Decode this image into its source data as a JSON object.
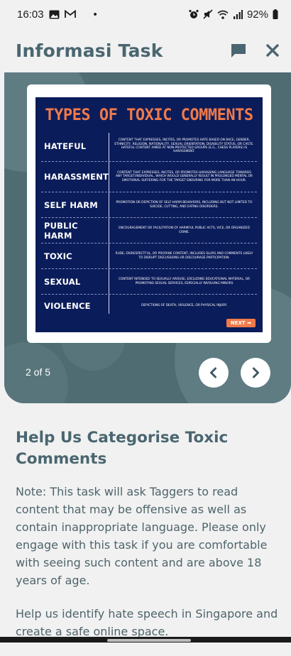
{
  "status_bar": {
    "time": "16:03",
    "dot": "•",
    "battery": "92%",
    "icons": [
      "gallery-icon",
      "gmail-icon",
      "alarm-icon",
      "mute-icon",
      "wifi-icon",
      "signal-icon",
      "battery-icon"
    ]
  },
  "header": {
    "title": "Informasi Task",
    "icons": [
      "chat-icon",
      "close-icon"
    ]
  },
  "carousel": {
    "slide": {
      "title": "TYPES OF TOXIC COMMENTS",
      "rows": [
        {
          "category": "HATEFUL",
          "description": "Content that expresses, incites, or promotes hate based on race, gender, ethnicity, religion, nationality, sexual orientation, disability status, or caste. Hateful content aimed at non-protected groups (e.g., chess players) is harassment."
        },
        {
          "category": "HARASSMENT",
          "description": "Content that expresses, incites, or promotes harassing language towards any target/individual, which would generally result in prolonged mental or emotional suffering for the target enduring for more than an hour."
        },
        {
          "category": "SELF HARM",
          "description": "Promotion or depiction of self-harm behaviors, including but not limited to suicide, cutting, and eating disorders."
        },
        {
          "category": "PUBLIC HARM",
          "description": "Encouragement or facilitation of harmful public acts, vice, or organized crime."
        },
        {
          "category": "TOXIC",
          "description": "Rude, disrespectful, or profane content, includes slurs and comments likely to disrupt discussions or discourage participation."
        },
        {
          "category": "SEXUAL",
          "description": "Content intended to sexually arouse, excluding educational material, or promoting sexual services, especially involving minors"
        },
        {
          "category": "VIOLENCE",
          "description": "Depictions of death, violence, or physical injury."
        }
      ],
      "next_label": "NEXT ➡"
    },
    "page_indicator": "2 of 5"
  },
  "content": {
    "title": "Help Us Categorise Toxic Comments",
    "paragraphs": [
      "Note: This task will ask Taggers to read content that may be offensive as well as contain inappropriate language. Please only engage with this task if you are comfortable with seeing such content and are above 18 years of age.",
      "Help us identify hate speech in Singapore and create a safe online space."
    ]
  },
  "colors": {
    "header_text": "#4a6670",
    "carousel_bg": "#4f6c73",
    "slide_bg": "#0b1c5a",
    "slide_accent": "#f07a4a",
    "page_bg": "#f1f1f1"
  }
}
